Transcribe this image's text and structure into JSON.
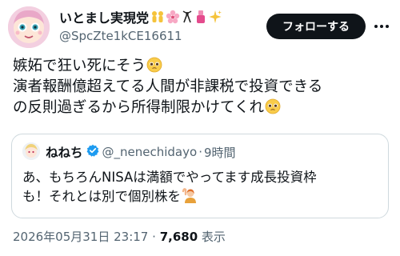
{
  "author": {
    "display_name": "いとまし実現党",
    "handle": "@SpcZte1kCE16611",
    "name_emojis": [
      "yellow-figures-icon",
      "cherry-blossom-icon",
      "ribbon-icon",
      "nail-polish-icon",
      "sparkles-icon"
    ]
  },
  "follow_button": {
    "label": "フォローする"
  },
  "tweet": {
    "lines": [
      "嫉妬で狂い死にそう",
      "演者報酬億超えてる人間が非課税で投資できる",
      "の反則過ぎるから所得制限かけてくれ"
    ]
  },
  "quoted_tweet": {
    "display_name": "ねねち",
    "handle": "@_nenechidayo",
    "separator": "·",
    "time": "9時間",
    "lines": [
      "あ、もちろんNISAは満額でやってます成長投資枠",
      "も！それとは別で個別株を"
    ]
  },
  "meta": {
    "timestamp": "2026年05月31日 23:17",
    "separator": "·",
    "views_count": "7,680",
    "views_label": "表示"
  },
  "colors": {
    "button_bg": "#0f1419",
    "secondary_text": "#536471",
    "border": "#cfd9de",
    "verified": "#1d9bf0"
  }
}
